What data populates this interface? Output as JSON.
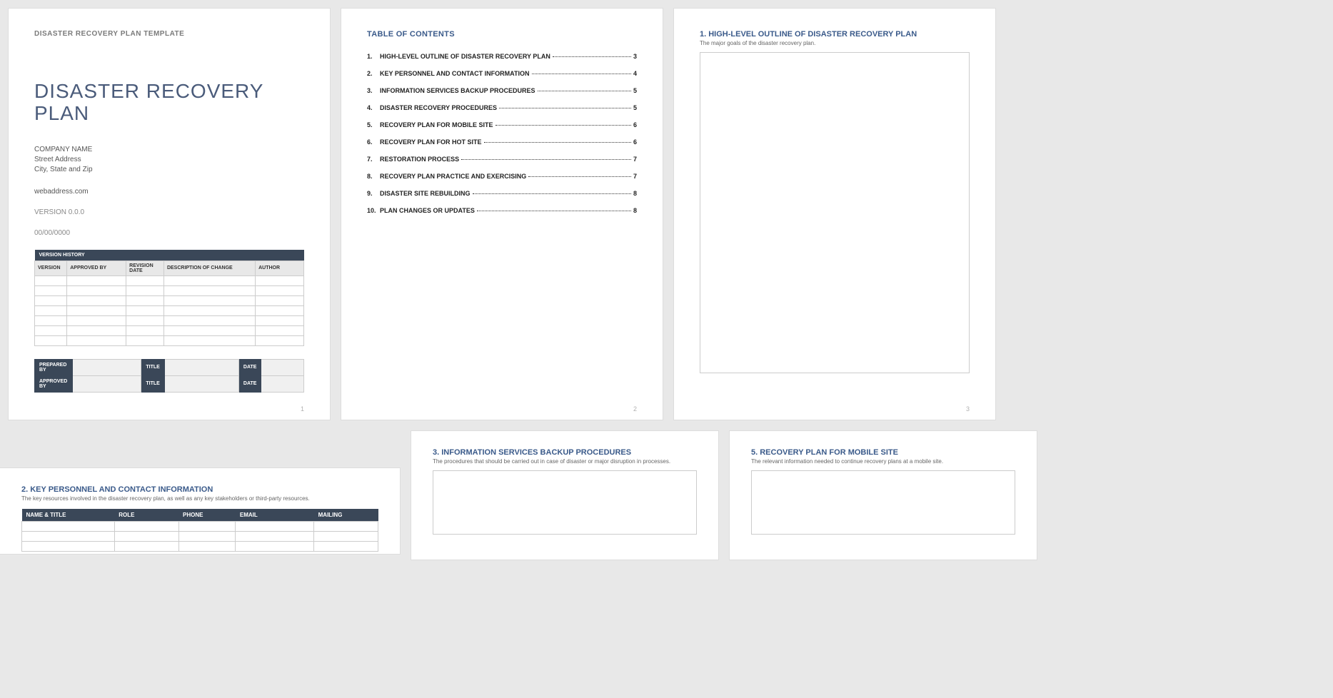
{
  "page1": {
    "header": "DISASTER RECOVERY PLAN TEMPLATE",
    "title_line1": "DISASTER RECOVERY",
    "title_line2": "PLAN",
    "company_name": "COMPANY NAME",
    "street": "Street Address",
    "city": "City, State and Zip",
    "web": "webaddress.com",
    "version": "VERSION 0.0.0",
    "date": "00/00/0000",
    "vh_banner": "VERSION HISTORY",
    "vh_cols": {
      "c1": "VERSION",
      "c2": "APPROVED BY",
      "c3": "REVISION DATE",
      "c4": "DESCRIPTION OF CHANGE",
      "c5": "AUTHOR"
    },
    "sig": {
      "prepared": "PREPARED BY",
      "approved": "APPROVED BY",
      "title": "TITLE",
      "date": "DATE"
    },
    "pagenum": "1"
  },
  "page2": {
    "title": "TABLE OF CONTENTS",
    "items": [
      {
        "n": "1.",
        "label": "HIGH-LEVEL OUTLINE OF DISASTER RECOVERY PLAN",
        "p": "3"
      },
      {
        "n": "2.",
        "label": "KEY PERSONNEL AND CONTACT INFORMATION",
        "p": "4"
      },
      {
        "n": "3.",
        "label": "INFORMATION SERVICES BACKUP PROCEDURES",
        "p": "5"
      },
      {
        "n": "4.",
        "label": "DISASTER RECOVERY PROCEDURES",
        "p": "5"
      },
      {
        "n": "5.",
        "label": "RECOVERY PLAN FOR MOBILE SITE",
        "p": "6"
      },
      {
        "n": "6.",
        "label": "RECOVERY PLAN FOR HOT SITE",
        "p": "6"
      },
      {
        "n": "7.",
        "label": "RESTORATION PROCESS",
        "p": "7"
      },
      {
        "n": "8.",
        "label": "RECOVERY PLAN PRACTICE AND EXERCISING",
        "p": "7"
      },
      {
        "n": "9.",
        "label": "DISASTER SITE REBUILDING",
        "p": "8"
      },
      {
        "n": "10.",
        "label": "PLAN CHANGES OR UPDATES",
        "p": "8"
      }
    ],
    "pagenum": "2"
  },
  "page3": {
    "title": "1.  HIGH-LEVEL OUTLINE OF DISASTER RECOVERY PLAN",
    "desc": "The major goals of the disaster recovery plan.",
    "pagenum": "3"
  },
  "page4": {
    "title": "2.  KEY PERSONNEL AND CONTACT INFORMATION",
    "desc": "The key resources involved in the disaster recovery plan, as well as any key stakeholders or third-party resources.",
    "cols": {
      "c1": "NAME & TITLE",
      "c2": "ROLE",
      "c3": "PHONE",
      "c4": "EMAIL",
      "c5": "MAILING"
    }
  },
  "page5": {
    "title": "3.  INFORMATION SERVICES BACKUP PROCEDURES",
    "desc": "The procedures that should be carried out in case of disaster or major disruption in processes."
  },
  "page6": {
    "title": "5.  RECOVERY PLAN FOR MOBILE SITE",
    "desc": "The relevant information needed to continue recovery plans at a mobile site."
  }
}
